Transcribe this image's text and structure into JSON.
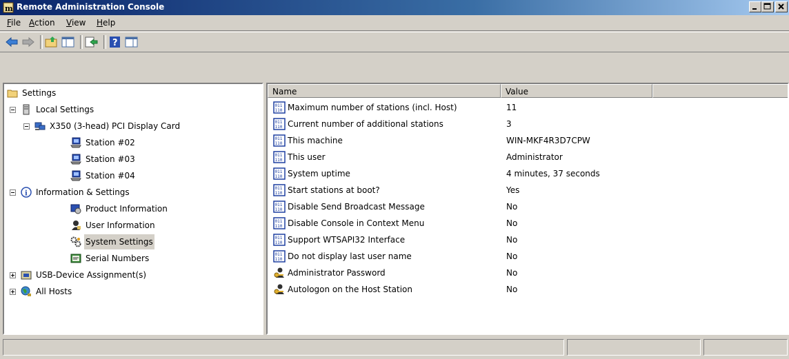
{
  "window": {
    "title": "Remote Administration Console"
  },
  "menu": [
    {
      "label": "File",
      "underline": "F",
      "rest": "ile"
    },
    {
      "label": "Action",
      "underline": "A",
      "rest": "ction"
    },
    {
      "label": "View",
      "underline": "V",
      "rest": "iew"
    },
    {
      "label": "Help",
      "underline": "H",
      "rest": "elp"
    }
  ],
  "toolbar": {
    "buttons": [
      "back-icon",
      "forward-icon",
      "up-folder-icon",
      "show-tree-icon",
      "export-icon",
      "help-icon",
      "properties-icon"
    ]
  },
  "tree": {
    "items": [
      {
        "label": "Settings",
        "icon": "folder-icon",
        "level": 0
      },
      {
        "label": "Local Settings",
        "icon": "server-icon",
        "level": 1,
        "expander": "minus"
      },
      {
        "label": "X350 (3-head)  PCI Display Card",
        "icon": "display-card-icon",
        "level": 2,
        "expander": "minus"
      },
      {
        "label": "Station #02",
        "icon": "station-icon",
        "level": 3
      },
      {
        "label": "Station #03",
        "icon": "station-icon",
        "level": 3
      },
      {
        "label": "Station #04",
        "icon": "station-icon",
        "level": 3
      },
      {
        "label": "Information & Settings",
        "icon": "info-icon",
        "level": 1,
        "expander": "minus"
      },
      {
        "label": "Product Information",
        "icon": "product-info-icon",
        "level": 2
      },
      {
        "label": "User Information",
        "icon": "user-info-icon",
        "level": 2
      },
      {
        "label": "System Settings",
        "icon": "system-settings-icon",
        "level": 2,
        "selected": true
      },
      {
        "label": "Serial Numbers",
        "icon": "serial-numbers-icon",
        "level": 2
      },
      {
        "label": "USB-Device Assignment(s)",
        "icon": "usb-icon",
        "level": 1,
        "expander": "plus"
      },
      {
        "label": "All Hosts",
        "icon": "all-hosts-icon",
        "level": 0,
        "expander": "plus"
      }
    ]
  },
  "list": {
    "columns": [
      "Name",
      "Value",
      ""
    ],
    "rows": [
      {
        "name": "Maximum number of stations (incl. Host)",
        "value": "11",
        "icon": "binary-value-icon"
      },
      {
        "name": "Current number of additional stations",
        "value": "3",
        "icon": "binary-value-icon"
      },
      {
        "name": "This machine",
        "value": "WIN-MKF4R3D7CPW",
        "icon": "binary-value-icon"
      },
      {
        "name": "This user",
        "value": "Administrator",
        "icon": "binary-value-icon"
      },
      {
        "name": "System uptime",
        "value": "4 minutes, 37 seconds",
        "icon": "binary-value-icon"
      },
      {
        "name": "Start stations at boot?",
        "value": "Yes",
        "icon": "binary-value-icon"
      },
      {
        "name": "Disable  Send Broadcast Message",
        "value": "No",
        "icon": "binary-value-icon"
      },
      {
        "name": "Disable Console in Context Menu",
        "value": "No",
        "icon": "binary-value-icon"
      },
      {
        "name": "Support WTSAPI32  Interface",
        "value": "No",
        "icon": "binary-value-icon"
      },
      {
        "name": "Do not display last user name",
        "value": "No",
        "icon": "binary-value-icon"
      },
      {
        "name": "Administrator Password",
        "value": "No",
        "icon": "key-user-icon"
      },
      {
        "name": "Autologon on the Host Station",
        "value": "No",
        "icon": "key-user-icon"
      }
    ]
  },
  "colors": {
    "titlebar_start": "#0a246a",
    "titlebar_end": "#a6caf0",
    "face": "#d4d0c8"
  }
}
